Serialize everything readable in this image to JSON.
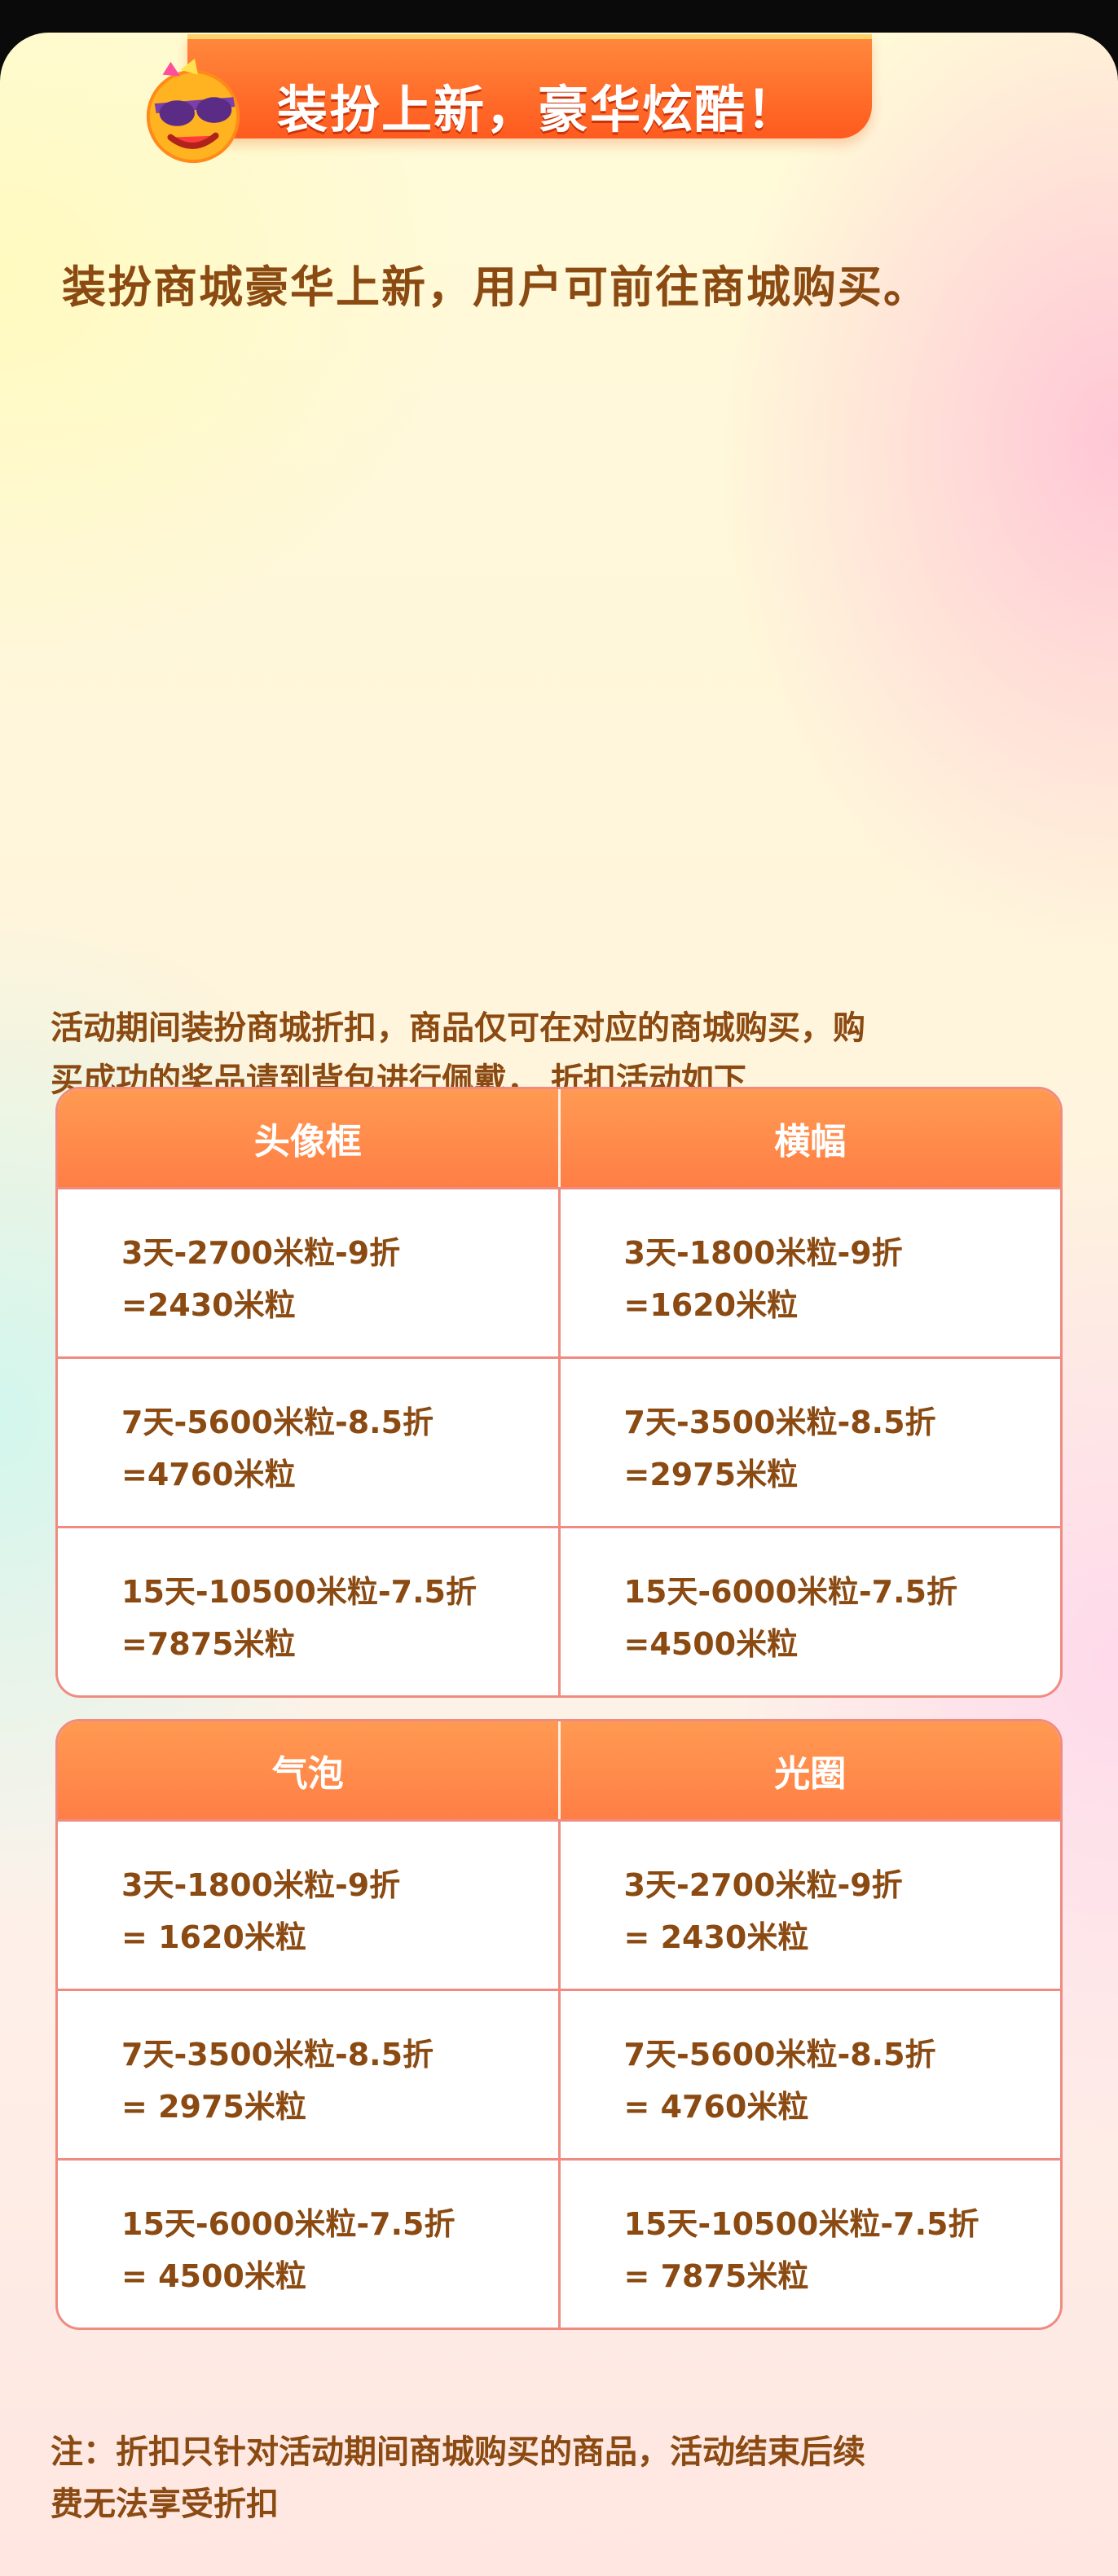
{
  "banner": {
    "title": "装扮上新，豪华炫酷！"
  },
  "intro": "装扮商城豪华上新，用户可前往商城购买。",
  "description": {
    "line1": "活动期间装扮商城折扣，商品仅可在对应的商城购买，购",
    "line2": "买成功的奖品请到背包进行佩戴， 折扣活动如下"
  },
  "tables": [
    {
      "headers": [
        "头像框",
        "横幅"
      ],
      "rows": [
        [
          [
            "3天-2700米粒-9折",
            "=2430米粒"
          ],
          [
            "3天-1800米粒-9折",
            "=1620米粒"
          ]
        ],
        [
          [
            "7天-5600米粒-8.5折",
            "=4760米粒"
          ],
          [
            "7天-3500米粒-8.5折",
            "=2975米粒"
          ]
        ],
        [
          [
            "15天-10500米粒-7.5折",
            "=7875米粒"
          ],
          [
            "15天-6000米粒-7.5折",
            "=4500米粒"
          ]
        ]
      ]
    },
    {
      "headers": [
        "气泡",
        "光圈"
      ],
      "rows": [
        [
          [
            "3天-1800米粒-9折",
            "= 1620米粒"
          ],
          [
            "3天-2700米粒-9折",
            "= 2430米粒"
          ]
        ],
        [
          [
            "7天-3500米粒-8.5折",
            "= 2975米粒"
          ],
          [
            "7天-5600米粒-8.5折",
            "= 4760米粒"
          ]
        ],
        [
          [
            "15天-6000米粒-7.5折",
            "= 4500米粒"
          ],
          [
            "15天-10500米粒-7.5折",
            "= 7875米粒"
          ]
        ]
      ]
    }
  ],
  "note": {
    "line1": "注：折扣只针对活动期间商城购买的商品，活动结束后续",
    "line2": "费无法享受折扣"
  },
  "icons": {
    "mascot": "sunglasses-face-icon"
  },
  "colors": {
    "accent": "#ff7e45",
    "text": "#8a4a12",
    "border": "#ef8b80"
  }
}
